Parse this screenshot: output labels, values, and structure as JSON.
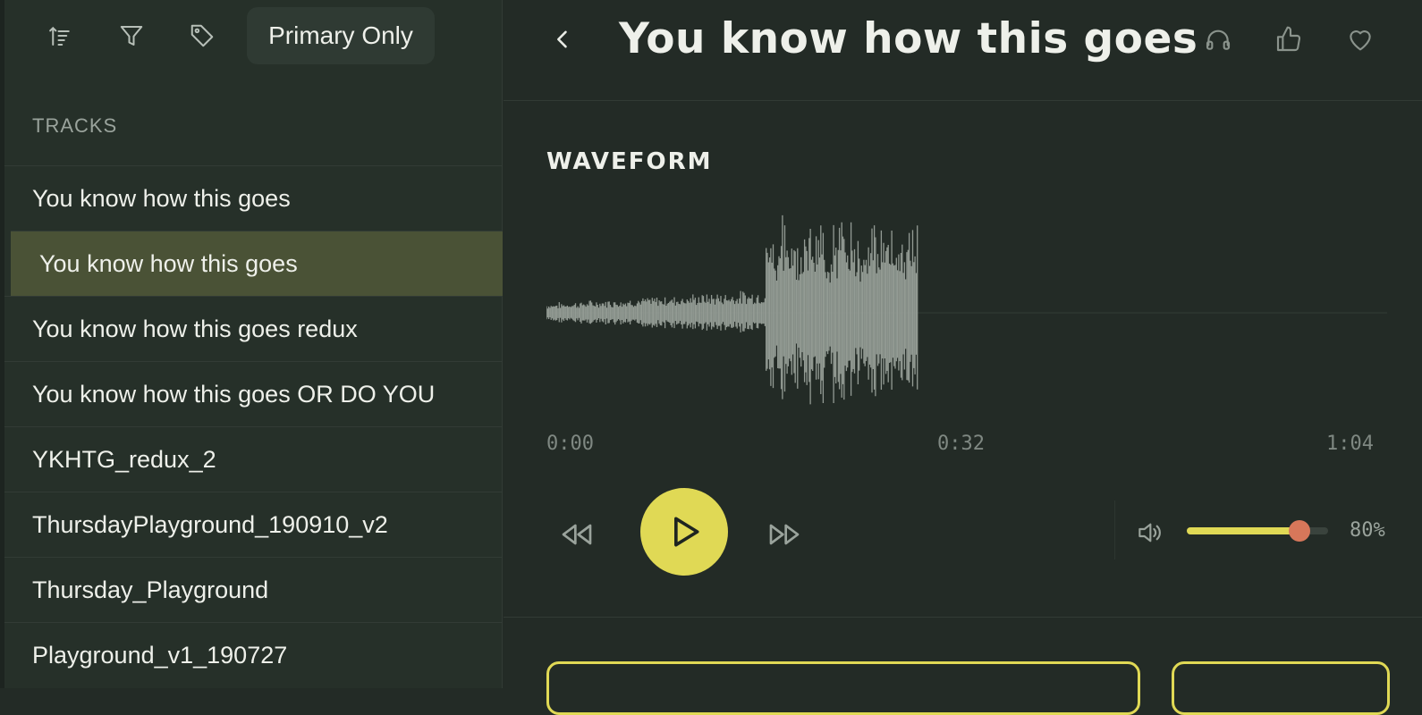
{
  "colors": {
    "accent": "#e0d955",
    "knob": "#d7775a",
    "active_row": "#4a5236",
    "background": "#232b26",
    "sidebar": "#263029"
  },
  "toolbar": {
    "icons": [
      "sort-icon",
      "filter-icon",
      "tag-icon"
    ],
    "primary_only_label": "Primary Only"
  },
  "sidebar": {
    "section_label": "TRACKS",
    "tracks": [
      {
        "label": "You know how this goes",
        "active": false
      },
      {
        "label": "You know how this goes",
        "active": true
      },
      {
        "label": "You know how this goes redux",
        "active": false
      },
      {
        "label": "You know how this goes OR DO YOU",
        "active": false
      },
      {
        "label": "YKHTG_redux_2",
        "active": false
      },
      {
        "label": "ThursdayPlayground_190910_v2",
        "active": false
      },
      {
        "label": "Thursday_Playground",
        "active": false
      },
      {
        "label": "Playground_v1_190727",
        "active": false
      }
    ]
  },
  "header": {
    "title": "You know how this goes",
    "icons": [
      "back-icon",
      "headphones-icon",
      "thumbs-up-icon",
      "heart-icon"
    ]
  },
  "player": {
    "waveform_label": "WAVEFORM",
    "time_start": "0:00",
    "time_mid": "0:32",
    "time_end": "1:04",
    "volume_percent": 80,
    "volume_label": "80%"
  }
}
